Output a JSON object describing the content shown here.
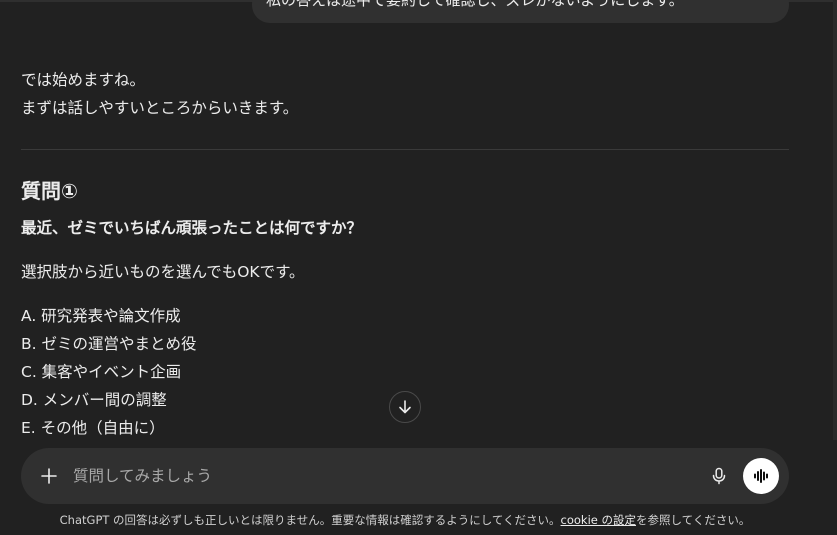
{
  "user_message": {
    "text": "私の答えは途中で要約して確認し、ズレがないようにします。"
  },
  "assistant": {
    "intro_lines": [
      "では始めますね。",
      "まずは話しやすいところからいきます。"
    ],
    "question_heading": "質問①",
    "question_text": "最近、ゼミでいちばん頑張ったことは何ですか？",
    "question_note": "選択肢から近いものを選んでもOKです。",
    "options": [
      "A. 研究発表や論文作成",
      "B. ゼミの運営やまとめ役",
      "C. 集客やイベント企画",
      "D. メンバー間の調整",
      "E. その他（自由に）"
    ]
  },
  "composer": {
    "placeholder": "質問してみましょう",
    "plus_icon": "plus-icon",
    "mic_icon": "microphone-icon",
    "voice_icon": "voice-mode-icon"
  },
  "scroll_down_icon": "arrow-down-icon",
  "footer": {
    "disclaimer_prefix": "ChatGPT の回答は必ずしも正しいとは限りません。重要な情報は確認するようにしてください。",
    "cookie_link": "cookie の設定",
    "disclaimer_suffix": "を参照してください。"
  },
  "colors": {
    "background": "#212121",
    "bubble": "#303030",
    "composer": "#303030",
    "text": "#ececec",
    "voice_button": "#ffffff"
  }
}
